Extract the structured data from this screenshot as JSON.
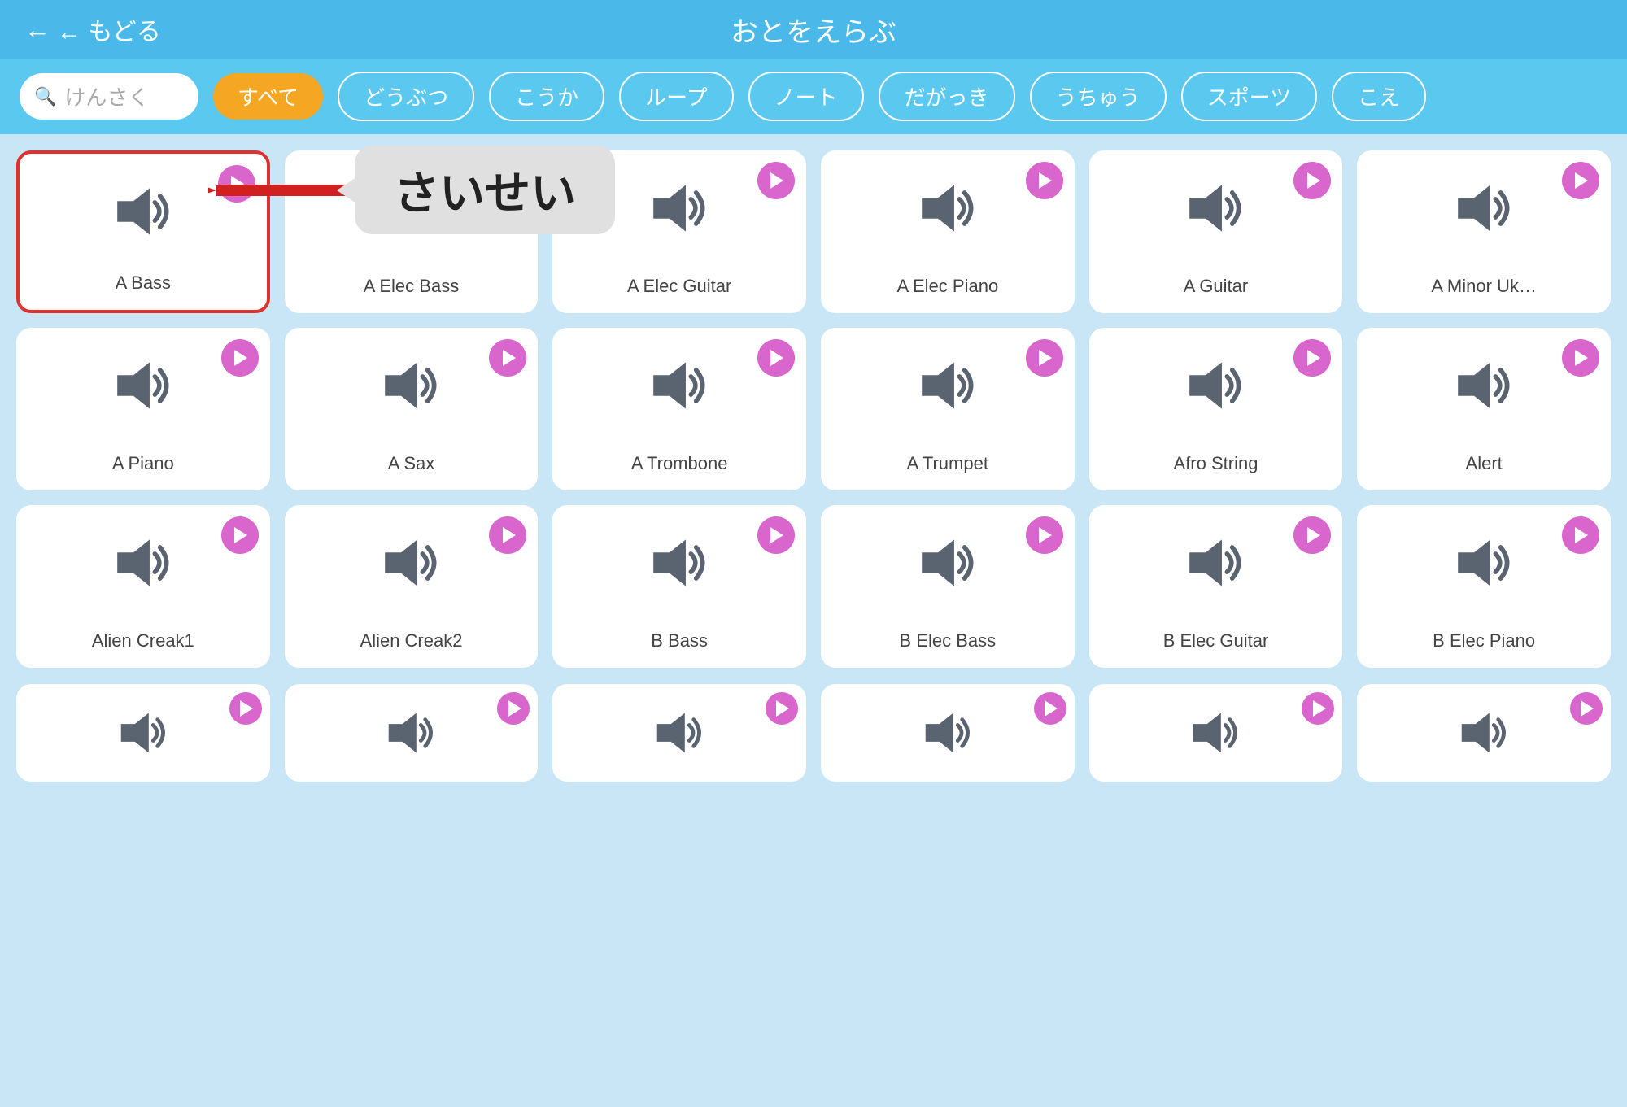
{
  "header": {
    "back_label": "← もどる",
    "title": "おとをえらぶ"
  },
  "search": {
    "placeholder": "けんさく"
  },
  "filters": [
    {
      "id": "all",
      "label": "すべて",
      "active": true
    },
    {
      "id": "animals",
      "label": "どうぶつ",
      "active": false
    },
    {
      "id": "effects",
      "label": "こうか",
      "active": false
    },
    {
      "id": "loop",
      "label": "ループ",
      "active": false
    },
    {
      "id": "note",
      "label": "ノート",
      "active": false
    },
    {
      "id": "percussion",
      "label": "だがっき",
      "active": false
    },
    {
      "id": "space",
      "label": "うちゅう",
      "active": false
    },
    {
      "id": "sports",
      "label": "スポーツ",
      "active": false
    },
    {
      "id": "voice",
      "label": "こえ",
      "active": false
    }
  ],
  "callout": {
    "text": "さいせい"
  },
  "sounds": [
    {
      "id": "a-bass",
      "label": "A Bass",
      "highlighted": true
    },
    {
      "id": "a-elec-bass",
      "label": "A Elec Bass",
      "highlighted": false
    },
    {
      "id": "a-elec-guitar",
      "label": "A Elec Guitar",
      "highlighted": false
    },
    {
      "id": "a-elec-piano",
      "label": "A Elec Piano",
      "highlighted": false
    },
    {
      "id": "a-guitar",
      "label": "A Guitar",
      "highlighted": false
    },
    {
      "id": "a-minor-uk",
      "label": "A Minor Uk…",
      "highlighted": false
    },
    {
      "id": "a-piano",
      "label": "A Piano",
      "highlighted": false
    },
    {
      "id": "a-sax",
      "label": "A Sax",
      "highlighted": false
    },
    {
      "id": "a-trombone",
      "label": "A Trombone",
      "highlighted": false
    },
    {
      "id": "a-trumpet",
      "label": "A Trumpet",
      "highlighted": false
    },
    {
      "id": "afro-string",
      "label": "Afro String",
      "highlighted": false
    },
    {
      "id": "alert",
      "label": "Alert",
      "highlighted": false
    },
    {
      "id": "alien-creak1",
      "label": "Alien Creak1",
      "highlighted": false
    },
    {
      "id": "alien-creak2",
      "label": "Alien Creak2",
      "highlighted": false
    },
    {
      "id": "b-bass",
      "label": "B Bass",
      "highlighted": false
    },
    {
      "id": "b-elec-bass",
      "label": "B Elec Bass",
      "highlighted": false
    },
    {
      "id": "b-elec-guitar",
      "label": "B Elec Guitar",
      "highlighted": false
    },
    {
      "id": "b-elec-piano",
      "label": "B Elec Piano",
      "highlighted": false
    }
  ],
  "partial_row": [
    {
      "id": "p1",
      "label": ""
    },
    {
      "id": "p2",
      "label": ""
    },
    {
      "id": "p3",
      "label": ""
    },
    {
      "id": "p4",
      "label": ""
    },
    {
      "id": "p5",
      "label": ""
    },
    {
      "id": "p6",
      "label": ""
    }
  ]
}
